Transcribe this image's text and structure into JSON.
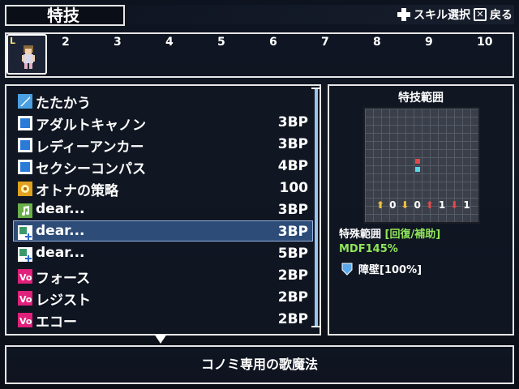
{
  "header": {
    "title": "特技",
    "hint_skill": "スキル選択",
    "hint_back": "戻る"
  },
  "party": {
    "slots": [
      "2",
      "3",
      "4",
      "5",
      "6",
      "7",
      "8",
      "9",
      "10"
    ],
    "leader_badge": "L"
  },
  "skills": [
    {
      "icon": "sword-icon",
      "name": "たたかう",
      "cost": ""
    },
    {
      "icon": "blue-skill-icon",
      "name": "アダルトキャノン",
      "cost": "3BP"
    },
    {
      "icon": "blue-skill-icon",
      "name": "レディーアンカー",
      "cost": "3BP"
    },
    {
      "icon": "blue-skill-icon",
      "name": "セクシーコンパス",
      "cost": "4BP"
    },
    {
      "icon": "gold-strategy-icon",
      "name": "オトナの策略",
      "cost": "100"
    },
    {
      "icon": "music-note-icon",
      "name": "dear...",
      "cost": "3BP"
    },
    {
      "icon": "heal-plus-icon",
      "name": "dear...",
      "cost": "3BP"
    },
    {
      "icon": "heal-plus-icon",
      "name": "dear...",
      "cost": "5BP"
    },
    {
      "icon": "vo-icon",
      "name": "フォース",
      "cost": "2BP"
    },
    {
      "icon": "vo-icon",
      "name": "レジスト",
      "cost": "2BP"
    },
    {
      "icon": "vo-icon",
      "name": "エコー",
      "cost": "2BP"
    }
  ],
  "selected_index": 6,
  "range_panel": {
    "title": "特技範囲",
    "counters": [
      "0",
      "0",
      "1",
      "1"
    ],
    "special_range_label": "特殊範囲",
    "special_range_value": "[回復/補助]",
    "mdf": "MDF145%",
    "barrier": "障壁[100%]"
  },
  "help_text": "コノミ専用の歌魔法",
  "colors": {
    "selection": "#2d4c78",
    "accent_green": "#8fe65a",
    "target_red": "#e04a4a",
    "target_cyan": "#5ad8e8"
  }
}
